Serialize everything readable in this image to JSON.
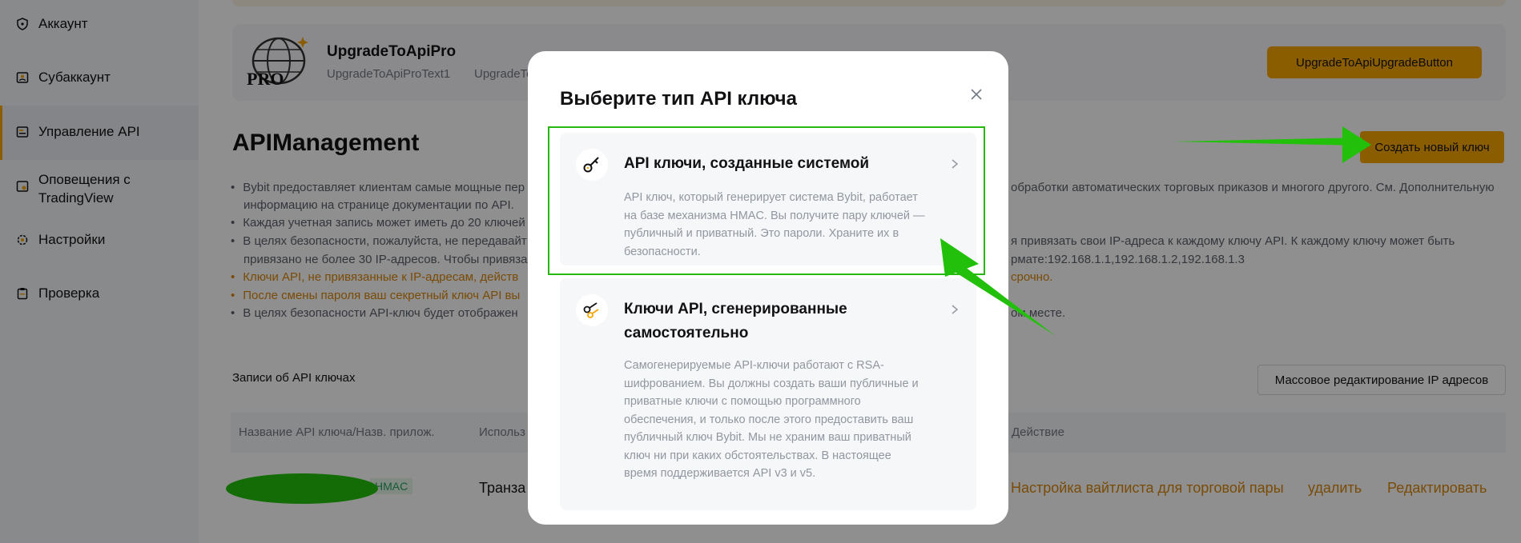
{
  "sidebar": {
    "items": [
      {
        "label": "Аккаунт",
        "icon": "shield-icon"
      },
      {
        "label": "Субаккаунт",
        "icon": "user-card-icon"
      },
      {
        "label": "Управление API",
        "icon": "api-card-icon"
      },
      {
        "label": "Оповещения с TradingView",
        "icon": "alert-icon"
      },
      {
        "label": "Настройки",
        "icon": "gear-icon"
      },
      {
        "label": "Проверка",
        "icon": "clipboard-icon"
      }
    ],
    "active_index": 2
  },
  "upgrade": {
    "title": "UpgradeToApiPro",
    "text1": "UpgradeToApiProText1",
    "text2": "UpgradeTo",
    "button": "UpgradeToApiUpgradeButton",
    "logo_text": "PRO"
  },
  "page": {
    "title": "APIManagement",
    "create_button": "Создать новый ключ",
    "bullets": [
      {
        "left": "Bybit предоставляет клиентам самые мощные пер",
        "right": "обработки автоматических торговых приказов и многого другого. См. Дополнительную",
        "cont": "информацию на странице документации по API."
      },
      {
        "left": "Каждая учетная запись может иметь до 20 ключей"
      },
      {
        "left": "В целях безопасности, пожалуйста, не передавайт",
        "right": "я привязать свои IP-адреса к каждому ключу API. К каждому ключу может быть",
        "cont_left": "привязано не более 30 IP-адресов. Чтобы привяза",
        "cont_right": "рмате:192.168.1.1,192.168.1.2,192.168.1.3"
      },
      {
        "left": "Ключи API, не привязанные к IP-адресам, действ",
        "right": "срочно.",
        "warn": true
      },
      {
        "left": "После смены пароля ваш секретный ключ API вы",
        "warn": true
      },
      {
        "left": "В целях безопасности API-ключ будет отображен",
        "right": "ом месте."
      }
    ],
    "records_label": "Записи об API ключах",
    "mass_edit_button": "Массовое редактирование IP адресов",
    "table": {
      "columns": [
        "Название API ключа/Назв. прилож.",
        "Использ",
        "Действие"
      ],
      "row": {
        "tag": "HMAC",
        "usage": "Транза",
        "actions": [
          "Настройка вайтлиста для торговой пары",
          "удалить",
          "Редактировать"
        ]
      }
    }
  },
  "modal": {
    "title": "Выберите тип API ключа",
    "options": [
      {
        "title": "API ключи, созданные системой",
        "icon": "key-icon",
        "desc": [
          "API ключ, который генерирует система Bybit, работает",
          "на базе механизма HMAC. Вы получите пару ключей —",
          "публичный и приватный. Это пароли. Храните их в",
          "безопасности."
        ]
      },
      {
        "title": "Ключи API, сгенерированные самостоятельно",
        "icon": "keys-icon",
        "desc": [
          "Самогенерируемые API-ключи работают с RSA-",
          "шифрованием. Вы должны создать ваши публичные и",
          "приватные ключи с помощью программного",
          "обеспечения, и только после этого предоставить ваш",
          "публичный ключ Bybit. Мы не храним ваш приватный",
          "ключ ни при каких обстоятельствах. В настоящее",
          "время поддерживается API v3 и v5."
        ]
      }
    ]
  },
  "colors": {
    "accent": "#f7a600",
    "annotation": "#22c00a",
    "warning_text": "#d9860b"
  }
}
